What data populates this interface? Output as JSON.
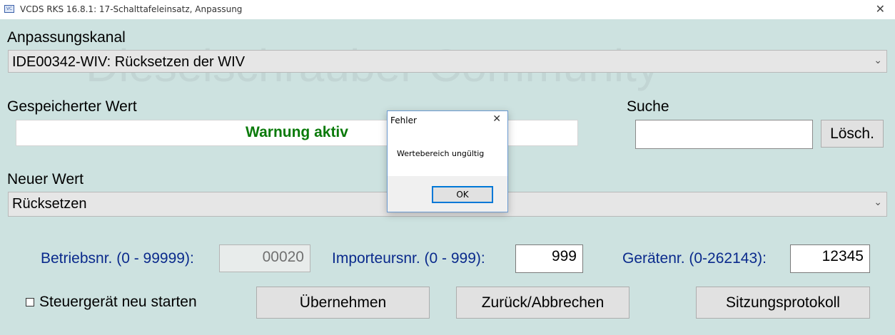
{
  "window": {
    "title": "VCDS RKS 16.8.1: 17-Schalttafeleinsatz,  Anpassung",
    "app_icon": "vcds-app-icon",
    "close_glyph": "✕"
  },
  "watermark": "Dieselschrauber Community",
  "channel": {
    "label": "Anpassungskanal",
    "value": "IDE00342-WIV: Rücksetzen der WIV"
  },
  "stored": {
    "label": "Gespeicherter Wert",
    "value": "Warnung aktiv",
    "value_color": "#0a7a0a"
  },
  "search": {
    "label": "Suche",
    "value": "",
    "clear_label": "Lösch."
  },
  "new_value": {
    "label": "Neuer Wert",
    "value": "Rücksetzen"
  },
  "codes": {
    "betriebsnr_label": "Betriebsnr. (0 - 99999):",
    "betriebsnr_value": "00020",
    "importeur_label": "Importeursnr. (0 - 999):",
    "importeur_value": "999",
    "geraet_label": "Gerätenr. (0-262143):",
    "geraet_value": "12345",
    "label_color": "#0a2a8c"
  },
  "actions": {
    "restart_label": "Steuergerät neu starten",
    "restart_checked": false,
    "apply_label": "Übernehmen",
    "cancel_label": "Zurück/Abbrechen",
    "log_label": "Sitzungsprotokoll"
  },
  "dialog": {
    "title": "Fehler",
    "message": "Wertebereich ungültig",
    "ok_label": "OK",
    "close_glyph": "✕"
  },
  "icons": [
    "vcds-app-icon",
    "close-icon",
    "chevron-down-icon",
    "checkbox-icon"
  ]
}
